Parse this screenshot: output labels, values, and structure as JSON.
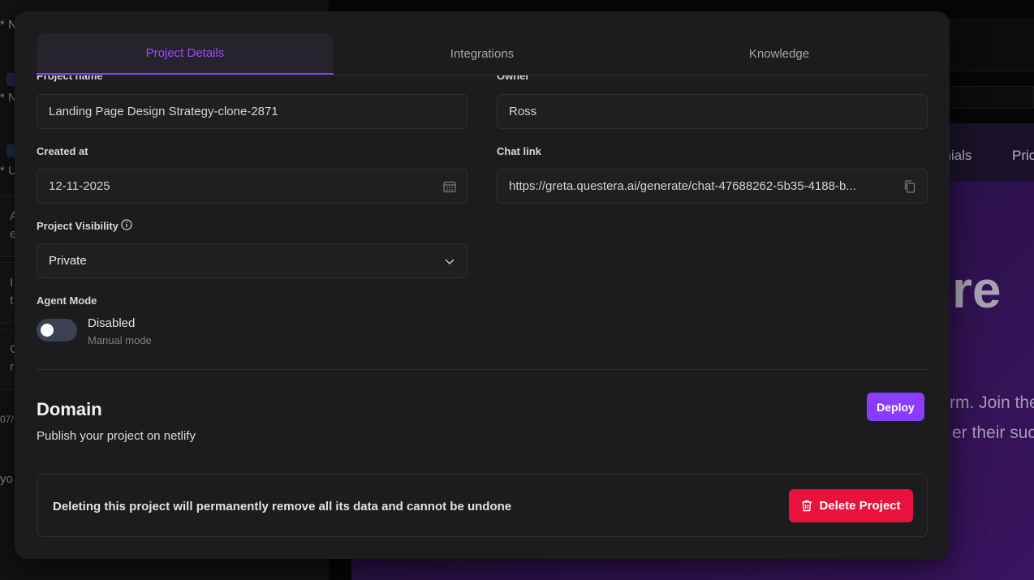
{
  "tabs": [
    {
      "label": "Project Details",
      "active": true
    },
    {
      "label": "Integrations",
      "active": false
    },
    {
      "label": "Knowledge",
      "active": false
    }
  ],
  "fields": {
    "project_name": {
      "label": "Project name",
      "value": "Landing Page Design Strategy-clone-2871"
    },
    "owner": {
      "label": "Owner",
      "value": "Ross"
    },
    "created_at": {
      "label": "Created at",
      "value": "12-11-2025"
    },
    "chat_link": {
      "label": "Chat link",
      "value": "https://greta.questera.ai/generate/chat-47688262-5b35-4188-b..."
    },
    "visibility": {
      "label": "Project Visibility",
      "value": "Private"
    },
    "agent_mode": {
      "label": "Agent Mode",
      "state": "Disabled",
      "description": "Manual mode",
      "enabled": false
    }
  },
  "domain": {
    "title": "Domain",
    "subtitle": "Publish your project on netlify",
    "deploy_label": "Deploy"
  },
  "danger": {
    "warning": "Deleting this project will permanently remove all its data and cannot be undone",
    "delete_label": "Delete Project"
  },
  "background": {
    "left_fragments": [
      "* N",
      "* N",
      "* U",
      "A",
      "e",
      "I",
      "t",
      "C",
      "r",
      "07/",
      "yo"
    ],
    "preview_nav": [
      "onials",
      "Pric"
    ],
    "preview_hero": "re",
    "preview_sub": [
      "rm. Join the",
      "er their succ"
    ]
  },
  "colors": {
    "accent": "#8a3dff",
    "danger": "#e8123c",
    "modal_bg": "#1c1c1e"
  }
}
